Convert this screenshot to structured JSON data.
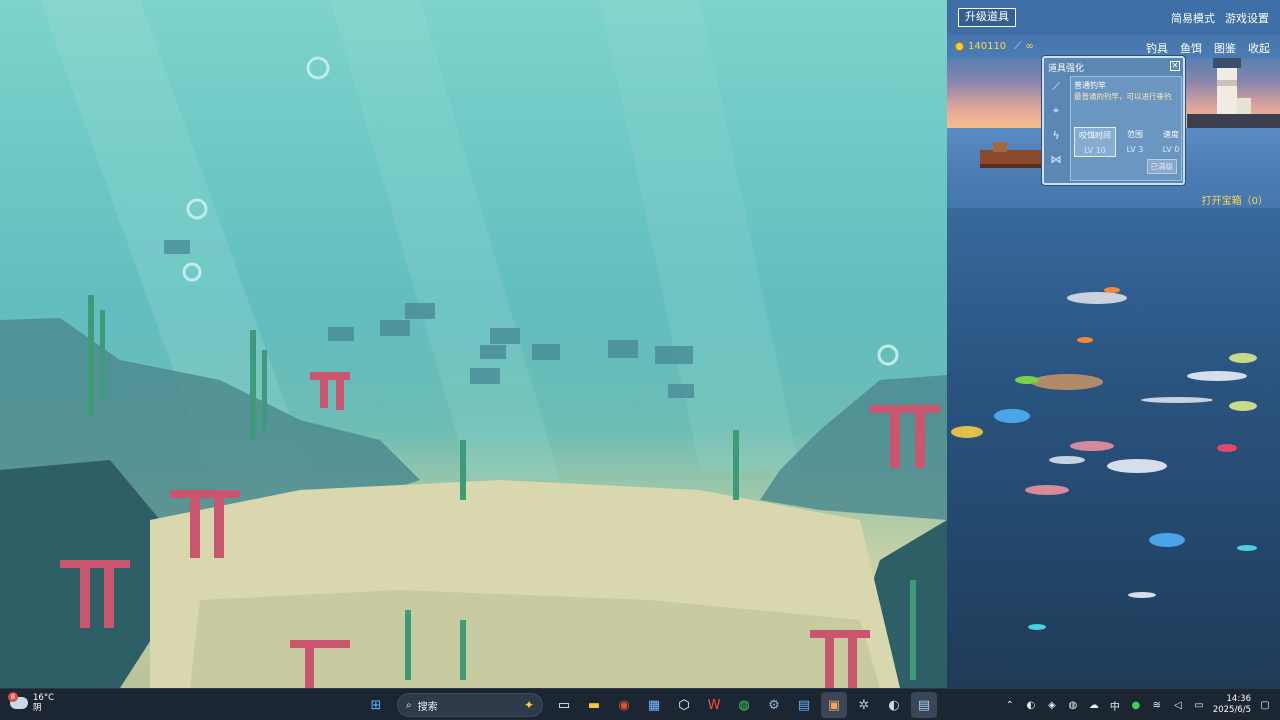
{
  "game": {
    "upgrade_button": "升级道具",
    "top_links": [
      "简易模式",
      "游戏设置"
    ],
    "coins": "140110",
    "rod_count": "∞",
    "menu": [
      "钓具",
      "鱼饵",
      "图鉴",
      "收起"
    ],
    "open_chest": "打开宝箱（0）",
    "panel": {
      "title": "道具强化",
      "rod_name": "普通钓竿",
      "rod_desc": "最普通的钓竿，可以进行垂钓",
      "stats": [
        {
          "label": "咬饵时间",
          "level": "LV 10"
        },
        {
          "label": "范围",
          "level": "LV 3"
        },
        {
          "label": "速度",
          "level": "LV 0"
        }
      ],
      "maxed": "已满级"
    }
  },
  "taskbar": {
    "weather": {
      "temp": "16°C",
      "condition": "阴",
      "badge": "8"
    },
    "search_placeholder": "搜索",
    "tray": {
      "ime": "中",
      "time": "14:36",
      "date": "2025/6/5"
    }
  },
  "colors": {
    "coin": "#ffd54a",
    "panel": "#5a87b4",
    "taskbar": "#1c2633"
  },
  "icons": [
    "windows-start-icon",
    "search-icon",
    "copilot-icon",
    "task-view-icon",
    "file-explorer-icon",
    "chrome-icon",
    "store-icon",
    "app-icon",
    "wps-icon",
    "wechat-icon",
    "settings-icon",
    "notepad-icon",
    "game-icon",
    "steam-icon",
    "fishing-game-icon"
  ]
}
